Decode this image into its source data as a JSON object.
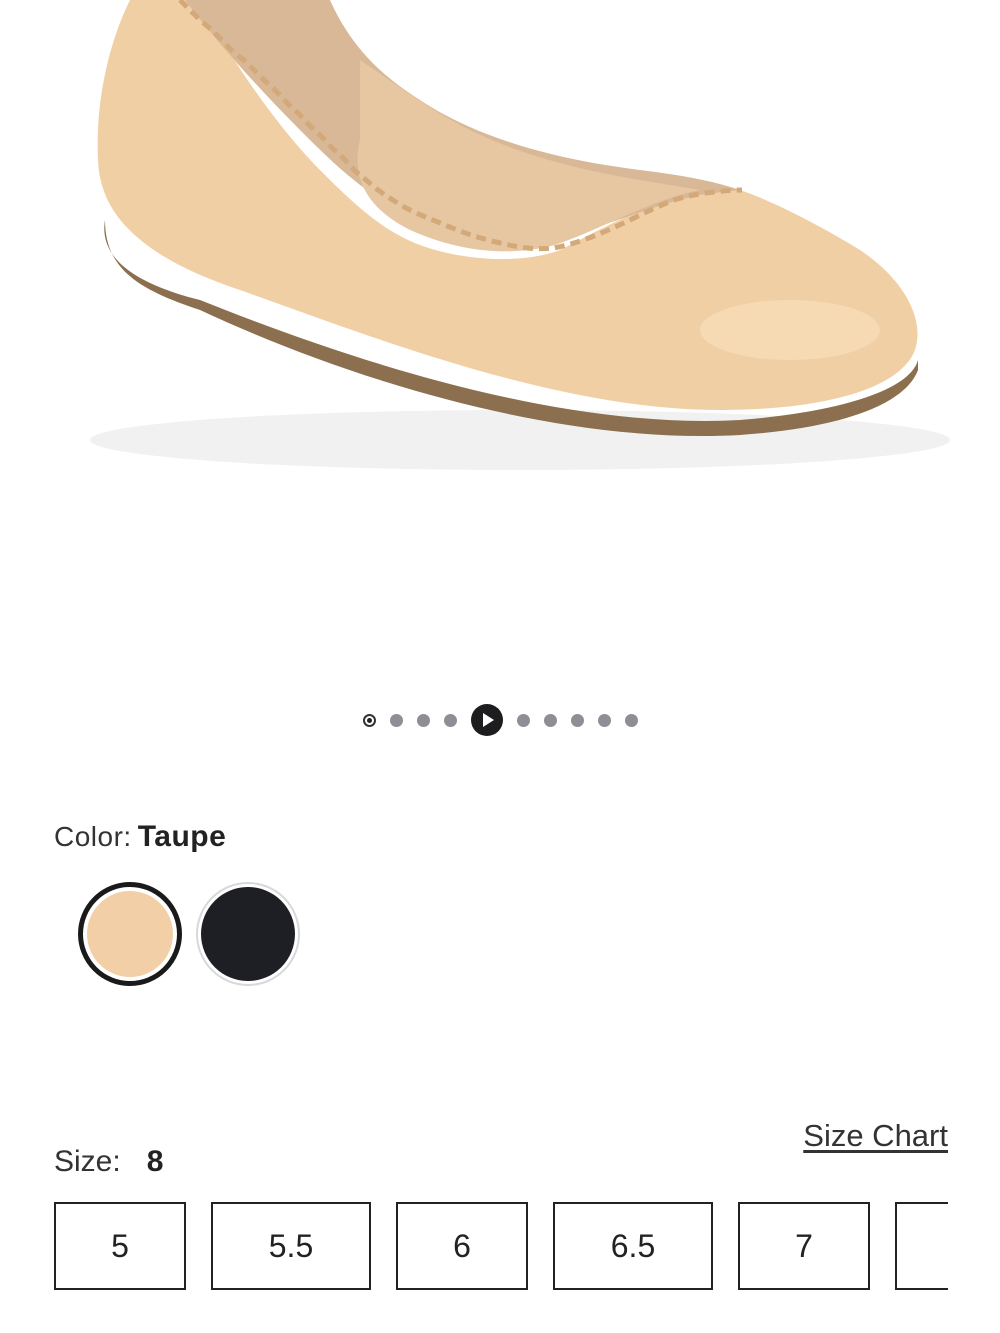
{
  "product": {
    "image_name": "taupe scalloped ballet flat"
  },
  "carousel": {
    "count": 10,
    "active_index": 0,
    "video_index": 4
  },
  "color": {
    "label": "Color:",
    "selected": "Taupe",
    "swatches": [
      {
        "name": "Taupe",
        "color": "#f2cfa6",
        "selected": true
      },
      {
        "name": "Black",
        "color": "#1e1f24",
        "selected": false
      }
    ]
  },
  "size": {
    "label": "Size:",
    "selected": "8",
    "chart_link": "Size Chart",
    "options": [
      "5",
      "5.5",
      "6",
      "6.5",
      "7",
      ""
    ]
  }
}
